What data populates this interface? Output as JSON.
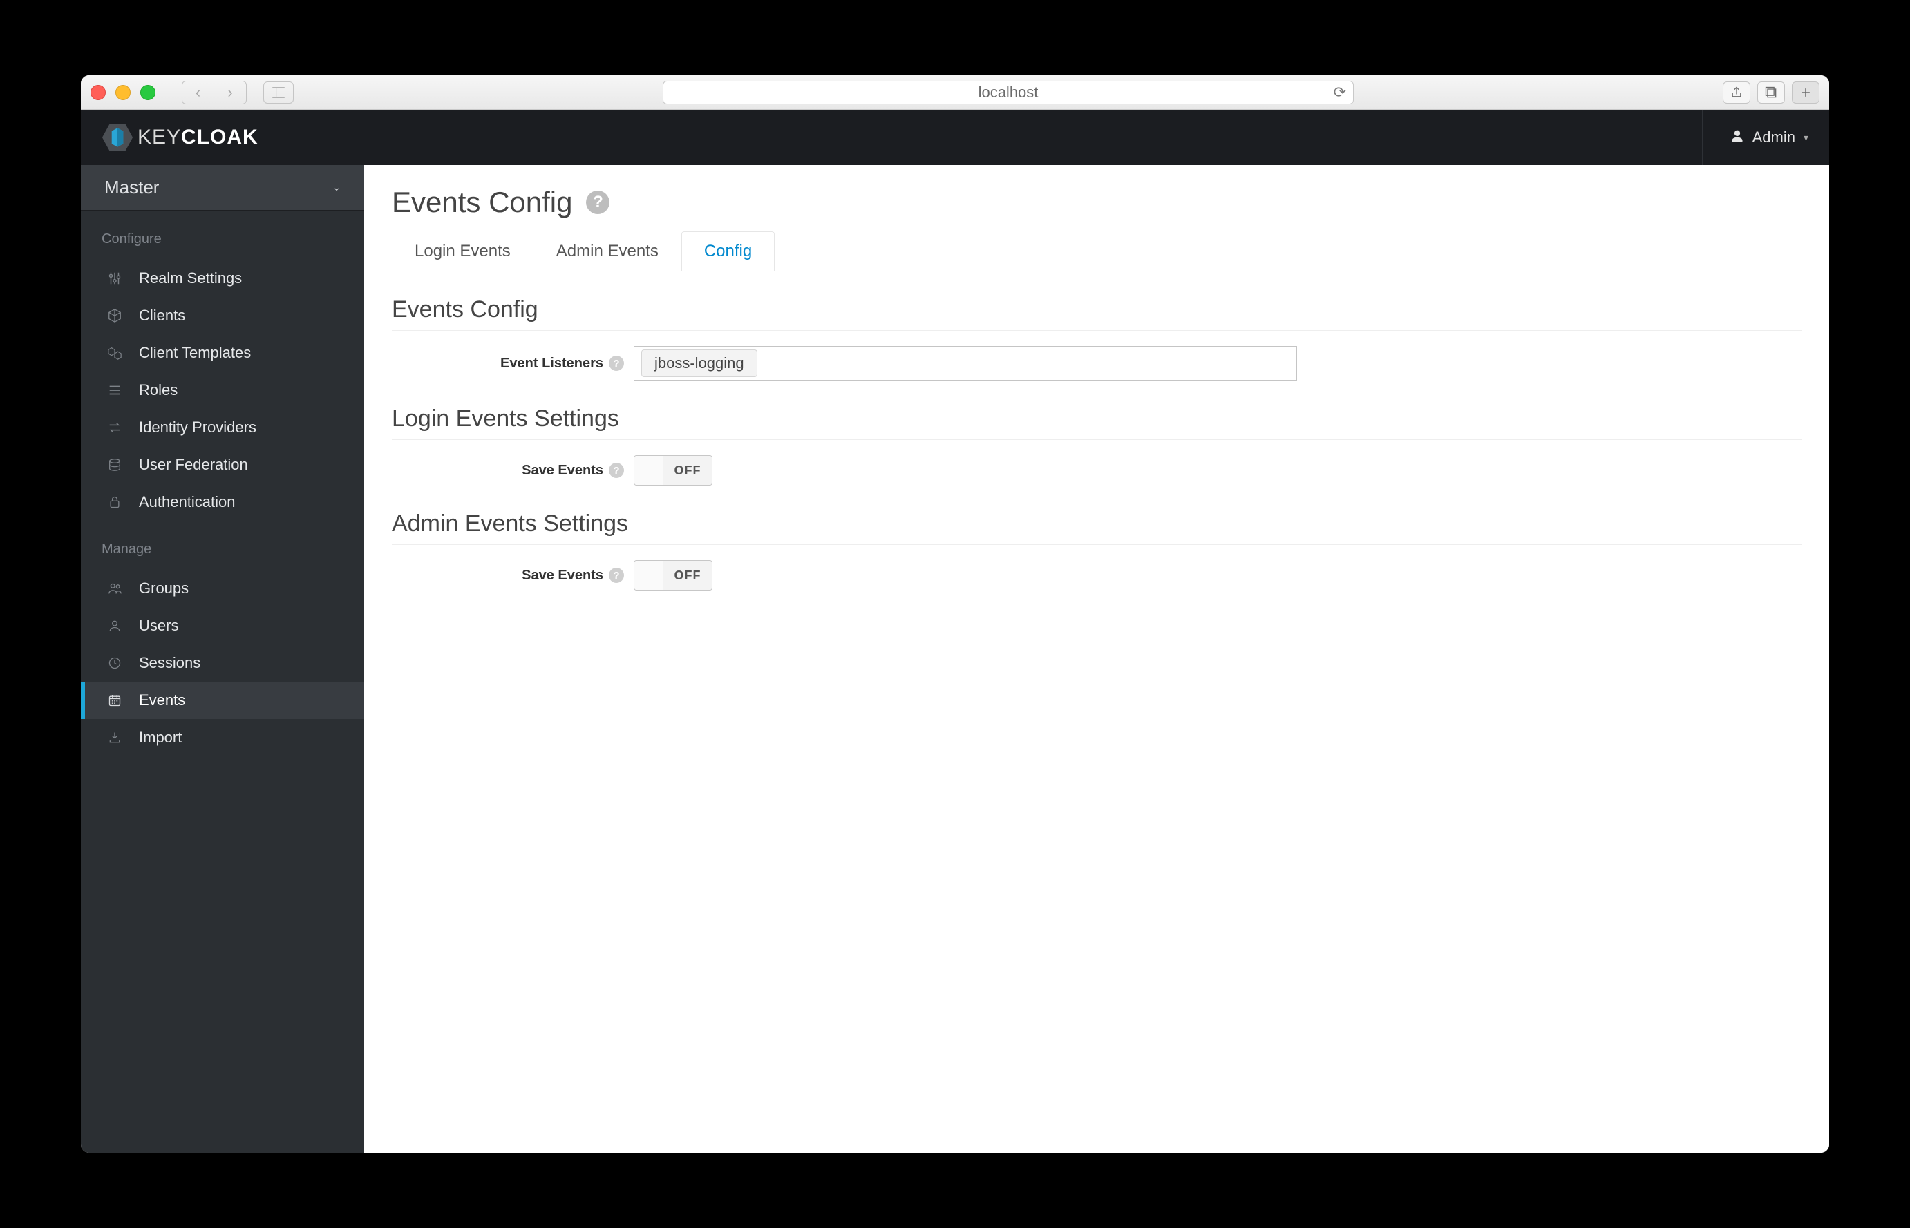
{
  "browser": {
    "url": "localhost"
  },
  "header": {
    "logo_plain": "KEY",
    "logo_bold": "CLOAK",
    "user": "Admin"
  },
  "sidebar": {
    "realm": "Master",
    "section_configure": "Configure",
    "section_manage": "Manage",
    "configure_items": {
      "realm_settings": "Realm Settings",
      "clients": "Clients",
      "client_templates": "Client Templates",
      "roles": "Roles",
      "identity_providers": "Identity Providers",
      "user_federation": "User Federation",
      "authentication": "Authentication"
    },
    "manage_items": {
      "groups": "Groups",
      "users": "Users",
      "sessions": "Sessions",
      "events": "Events",
      "import": "Import"
    }
  },
  "page": {
    "title": "Events Config",
    "tabs": {
      "login": "Login Events",
      "admin": "Admin Events",
      "config": "Config"
    },
    "sections": {
      "events_config": "Events Config",
      "login_events_settings": "Login Events Settings",
      "admin_events_settings": "Admin Events Settings"
    },
    "labels": {
      "event_listeners": "Event Listeners",
      "save_events": "Save Events"
    },
    "event_listener_tag": "jboss-logging",
    "toggle_off": "OFF"
  }
}
